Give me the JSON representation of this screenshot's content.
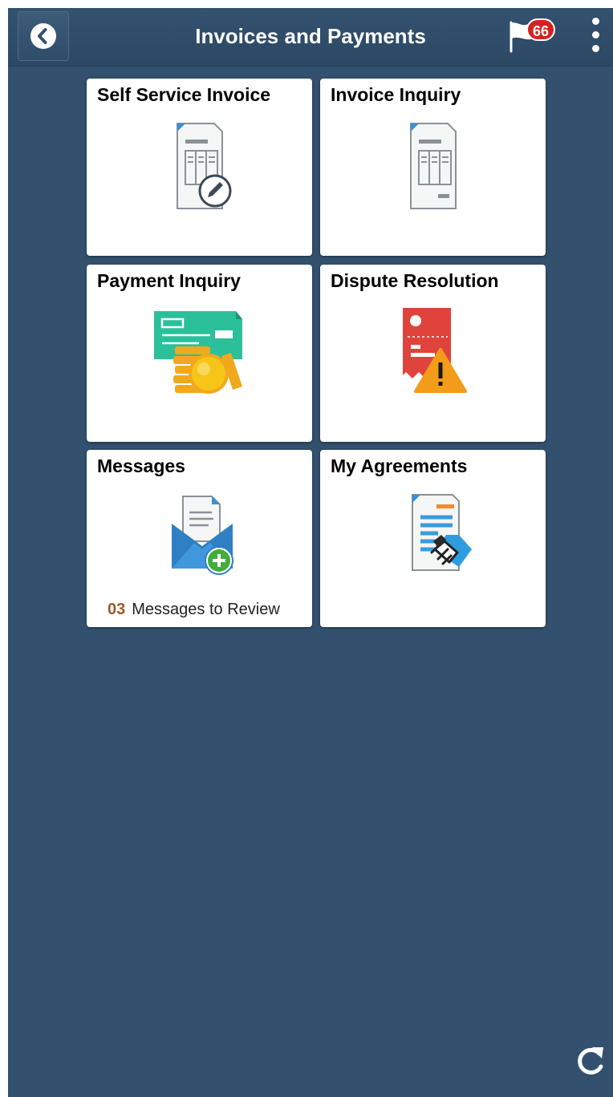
{
  "header": {
    "title": "Invoices and Payments",
    "back_icon": "back-arrow-icon",
    "notification_icon": "flag-icon",
    "notification_count": "66",
    "menu_icon": "vertical-dots-menu-icon"
  },
  "tiles": [
    {
      "title": "Self Service Invoice",
      "icon": "invoice-edit-icon"
    },
    {
      "title": "Invoice Inquiry",
      "icon": "invoice-document-icon"
    },
    {
      "title": "Payment Inquiry",
      "icon": "check-and-coins-icon"
    },
    {
      "title": "Dispute Resolution",
      "icon": "receipt-warning-icon"
    },
    {
      "title": "Messages",
      "icon": "envelope-add-icon",
      "count": "03",
      "count_label": "Messages to Review"
    },
    {
      "title": "My Agreements",
      "icon": "agreement-handshake-icon"
    }
  ],
  "footer": {
    "refresh_icon": "refresh-icon"
  },
  "colors": {
    "background": "#33516e",
    "badge": "#d42222",
    "count_number": "#9c5a2c"
  }
}
